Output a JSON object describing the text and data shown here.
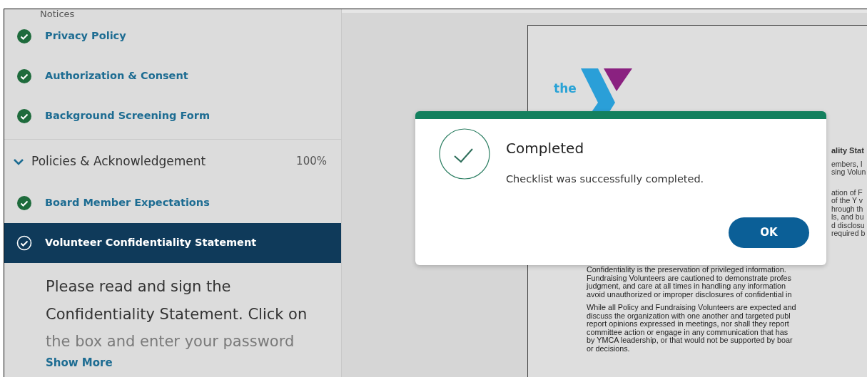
{
  "sidebar": {
    "section_heading": "Notices",
    "items": [
      {
        "label": "Privacy Policy",
        "completed": true,
        "selected": false
      },
      {
        "label": "Authorization & Consent",
        "completed": true,
        "selected": false
      },
      {
        "label": "Background Screening Form",
        "completed": true,
        "selected": false
      }
    ],
    "section": {
      "title": "Policies & Acknowledgement",
      "expanded": true,
      "progress": "100%",
      "items": [
        {
          "label": "Board Member Expectations",
          "completed": true,
          "selected": false
        },
        {
          "label": "Volunteer Confidentiality Statement",
          "completed": true,
          "selected": true
        }
      ]
    },
    "description": [
      "Please read and sign the",
      "Confidentiality Statement. Click on",
      "the box and enter your password"
    ],
    "show_more": "Show More"
  },
  "document": {
    "logo_text": "the",
    "fragments": [
      {
        "text": "ality Stat",
        "kind": "heading"
      },
      {
        "text": "embers, I",
        "kind": "line"
      },
      {
        "text": "sing Volun",
        "kind": "line"
      },
      {
        "text": "ation of F",
        "kind": "gap"
      },
      {
        "text": "of the Y v",
        "kind": "line"
      },
      {
        "text": "hrough th",
        "kind": "line"
      },
      {
        "text": "ls, and bu",
        "kind": "line"
      },
      {
        "text": "d disclosu",
        "kind": "line"
      },
      {
        "text": "required b",
        "kind": "line"
      }
    ],
    "paragraphs": [
      [
        "Confidentiality is the preservation of privileged information.",
        "Fundraising Volunteers are cautioned to demonstrate profes",
        "judgment, and care at all times in handling any information",
        "avoid unauthorized or improper disclosures of confidential in"
      ],
      [
        "While all Policy and Fundraising Volunteers are expected and",
        "discuss the organization with one another and targeted publ",
        "report opinions expressed in meetings, nor shall they report",
        "committee action or engage in any communication that has",
        "by YMCA leadership, or that would not be supported by boar",
        "or decisions."
      ]
    ]
  },
  "dialog": {
    "title": "Completed",
    "message": "Checklist was successfully completed.",
    "button": "OK"
  }
}
